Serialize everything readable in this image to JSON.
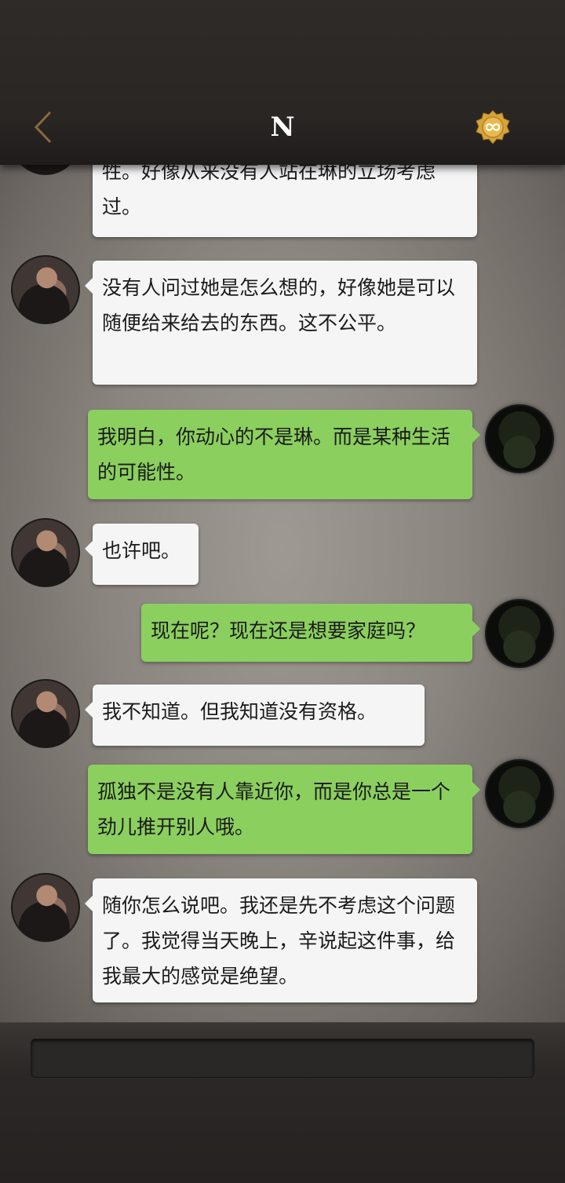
{
  "header": {
    "title": "N",
    "back_icon": "chevron-left-icon",
    "badge_icon": "infinity-badge-icon",
    "badge_color": "#d7a43c"
  },
  "messages": [
    {
      "side": "left",
      "text": "牲。好像从来没有人站在琳的立场考虑过。"
    },
    {
      "side": "left",
      "text": "没有人问过她是怎么想的，好像她是可以随便给来给去的东西。这不公平。"
    },
    {
      "side": "right",
      "text": "我明白，你动心的不是琳。而是某种生活的可能性。"
    },
    {
      "side": "left",
      "text": "也许吧。"
    },
    {
      "side": "right",
      "text": "现在呢？现在还是想要家庭吗？"
    },
    {
      "side": "left",
      "text": "我不知道。但我知道没有资格。"
    },
    {
      "side": "right",
      "text": "孤独不是没有人靠近你，而是你总是一个劲儿推开别人哦。"
    },
    {
      "side": "left",
      "text": "随你怎么说吧。我还是先不考虑这个问题了。我觉得当天晚上，辛说起这件事，给我最大的感觉是绝望。"
    }
  ],
  "colors": {
    "left_bubble": "#f5f5f5",
    "right_bubble": "#8bcf5f",
    "back_icon": "#8a6a3c"
  },
  "input": {
    "placeholder": ""
  }
}
